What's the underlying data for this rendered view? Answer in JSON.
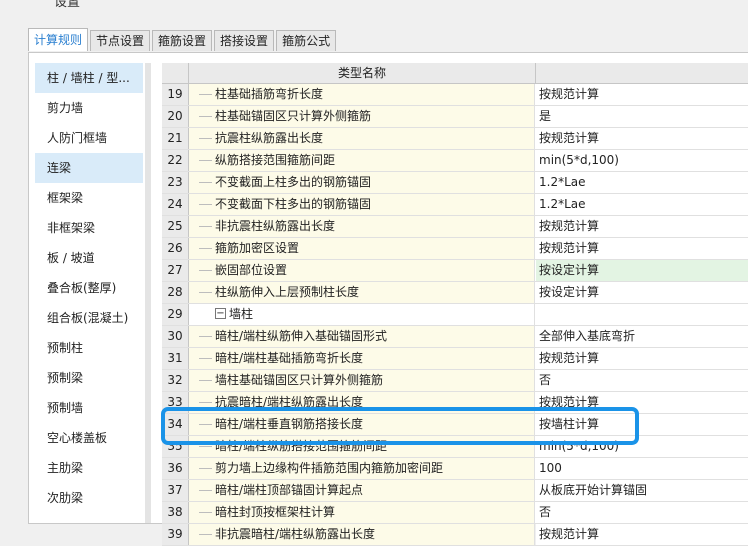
{
  "window": {
    "title_fragment": "设置"
  },
  "tabs": [
    {
      "label": "计算规则",
      "active": true
    },
    {
      "label": "节点设置",
      "active": false
    },
    {
      "label": "箍筋设置",
      "active": false
    },
    {
      "label": "搭接设置",
      "active": false
    },
    {
      "label": "箍筋公式",
      "active": false
    }
  ],
  "sidebar": {
    "items": [
      {
        "label": "柱 / 墙柱 / 型...",
        "selected": true
      },
      {
        "label": "剪力墙",
        "selected": false
      },
      {
        "label": "人防门框墙",
        "selected": false
      },
      {
        "label": "连梁",
        "selected": true
      },
      {
        "label": "框架梁",
        "selected": false
      },
      {
        "label": "非框架梁",
        "selected": false
      },
      {
        "label": "板 / 坡道",
        "selected": false
      },
      {
        "label": "叠合板(整厚)",
        "selected": false
      },
      {
        "label": "组合板(混凝土)",
        "selected": false
      },
      {
        "label": "预制柱",
        "selected": false
      },
      {
        "label": "预制梁",
        "selected": false
      },
      {
        "label": "预制墙",
        "selected": false
      },
      {
        "label": "空心楼盖板",
        "selected": false
      },
      {
        "label": "主肋梁",
        "selected": false
      },
      {
        "label": "次肋梁",
        "selected": false
      }
    ]
  },
  "table": {
    "header": {
      "name_col": "类型名称"
    },
    "rows": [
      {
        "num": "19",
        "name": "柱基础插筋弯折长度",
        "value": "按规范计算"
      },
      {
        "num": "20",
        "name": "柱基础锚固区只计算外侧箍筋",
        "value": "是"
      },
      {
        "num": "21",
        "name": "抗震柱纵筋露出长度",
        "value": "按规范计算"
      },
      {
        "num": "22",
        "name": "纵筋搭接范围箍筋间距",
        "value": "min(5*d,100)"
      },
      {
        "num": "23",
        "name": "不变截面上柱多出的钢筋锚固",
        "value": "1.2*Lae"
      },
      {
        "num": "24",
        "name": "不变截面下柱多出的钢筋锚固",
        "value": "1.2*Lae"
      },
      {
        "num": "25",
        "name": "非抗震柱纵筋露出长度",
        "value": "按规范计算"
      },
      {
        "num": "26",
        "name": "箍筋加密区设置",
        "value": "按规范计算"
      },
      {
        "num": "27",
        "name": "嵌固部位设置",
        "value": "按设定计算",
        "green": true
      },
      {
        "num": "28",
        "name": "柱纵筋伸入上层预制柱长度",
        "value": "按设定计算"
      },
      {
        "num": "29",
        "name": "墙柱",
        "value": "",
        "group": true,
        "toggle": "−"
      },
      {
        "num": "30",
        "name": "暗柱/端柱纵筋伸入基础锚固形式",
        "value": "全部伸入基底弯折"
      },
      {
        "num": "31",
        "name": "暗柱/端柱基础插筋弯折长度",
        "value": "按规范计算"
      },
      {
        "num": "32",
        "name": "墙柱基础锚固区只计算外侧箍筋",
        "value": "否"
      },
      {
        "num": "33",
        "name": "抗震暗柱/端柱纵筋露出长度",
        "value": "按规范计算"
      },
      {
        "num": "34",
        "name": "暗柱/端柱垂直钢筋搭接长度",
        "value": "按墙柱计算"
      },
      {
        "num": "35",
        "name": "暗柱/端柱纵筋搭接范围箍筋间距",
        "value": "min(5*d,100)"
      },
      {
        "num": "36",
        "name": "剪力墙上边缘构件插筋范围内箍筋加密间距",
        "value": "100"
      },
      {
        "num": "37",
        "name": "暗柱/端柱顶部锚固计算起点",
        "value": "从板底开始计算锚固"
      },
      {
        "num": "38",
        "name": "暗柱封顶按框架柱计算",
        "value": "否"
      },
      {
        "num": "39",
        "name": "非抗震暗柱/端柱纵筋露出长度",
        "value": "按规范计算"
      }
    ]
  },
  "highlight": {
    "row_num": "35",
    "color": "#1a93e8"
  }
}
